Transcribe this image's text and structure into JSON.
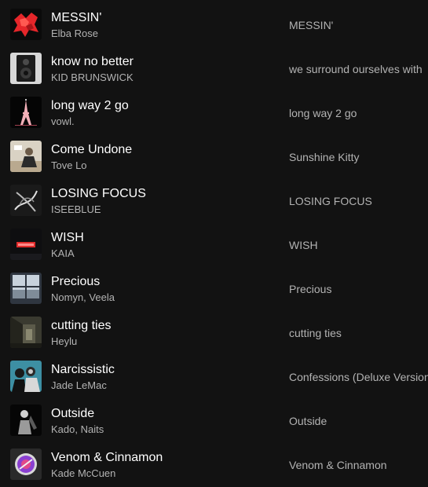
{
  "tracks": [
    {
      "title": "MESSIN'",
      "artists": "Elba Rose",
      "album": "MESSIN'",
      "cover_icon": "red-crumpled-figure-icon"
    },
    {
      "title": "know no better",
      "artists": "KID BRUNSWICK",
      "album": "we surround ourselves with",
      "cover_icon": "speaker-photo-icon"
    },
    {
      "title": "long way 2 go",
      "artists": "vowl.",
      "album": "long way 2 go",
      "cover_icon": "eiffel-tower-icon"
    },
    {
      "title": "Come Undone",
      "artists": "Tove Lo",
      "album": "Sunshine Kitty",
      "cover_icon": "portrait-photo-icon"
    },
    {
      "title": "LOSING FOCUS",
      "artists": "ISEEBLUE",
      "album": "LOSING FOCUS",
      "cover_icon": "abstract-swirl-icon"
    },
    {
      "title": "WISH",
      "artists": "KAIA",
      "album": "WISH",
      "cover_icon": "wish-neon-logo-icon"
    },
    {
      "title": "Precious",
      "artists": "Nomyn, Veela",
      "album": "Precious",
      "cover_icon": "window-landscape-icon"
    },
    {
      "title": "cutting ties",
      "artists": "Heylu",
      "album": "cutting ties",
      "cover_icon": "dark-room-icon"
    },
    {
      "title": "Narcissistic",
      "artists": "Jade LeMac",
      "album": "Confessions (Deluxe Version)",
      "cover_icon": "group-portrait-icon"
    },
    {
      "title": "Outside",
      "artists": "Kado, Naits",
      "album": "Outside",
      "cover_icon": "silhouette-figure-icon"
    },
    {
      "title": "Venom & Cinnamon",
      "artists": "Kade McCuen",
      "album": "Venom & Cinnamon",
      "cover_icon": "purple-orb-icon"
    }
  ]
}
